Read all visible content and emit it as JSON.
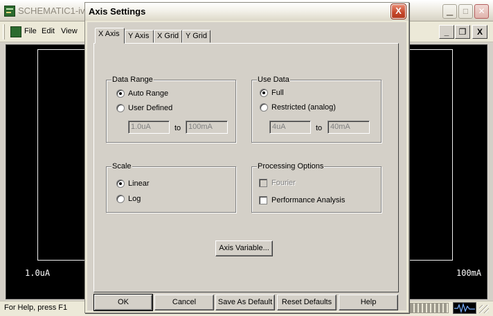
{
  "app": {
    "title": "SCHEMATIC1-iv",
    "menu": [
      "File",
      "Edit",
      "View"
    ],
    "window_buttons": [
      "minimize-icon",
      "maximize-icon",
      "close-icon"
    ],
    "mdi_buttons": {
      "minimize": "_",
      "restore": "❐",
      "close": "X"
    },
    "plot": {
      "x_min_label": "1.0uA",
      "x_max_label": "100mA",
      "background": "#000000"
    },
    "status_text": "For Help, press F1"
  },
  "dialog": {
    "title": "Axis Settings",
    "close_glyph": "X",
    "tabs": [
      {
        "label": "X Axis",
        "active": true
      },
      {
        "label": "Y Axis",
        "active": false
      },
      {
        "label": "X Grid",
        "active": false
      },
      {
        "label": "Y Grid",
        "active": false
      }
    ],
    "data_range": {
      "label": "Data Range",
      "auto_range": "Auto Range",
      "user_defined": "User Defined",
      "selected": "auto_range",
      "from_value": "1.0uA",
      "to_label": "to",
      "to_value": "100mA"
    },
    "use_data": {
      "label": "Use Data",
      "full": "Full",
      "restricted": "Restricted (analog)",
      "selected": "full",
      "from_value": "4uA",
      "to_label": "to",
      "to_value": "40mA"
    },
    "scale": {
      "label": "Scale",
      "linear": "Linear",
      "log": "Log",
      "selected": "linear"
    },
    "processing": {
      "label": "Processing Options",
      "fourier": "Fourier",
      "performance": "Performance Analysis"
    },
    "axis_variable_button": "Axis Variable...",
    "buttons": {
      "ok": "OK",
      "cancel": "Cancel",
      "save_default": "Save As Default",
      "reset_defaults": "Reset Defaults",
      "help": "Help"
    }
  }
}
